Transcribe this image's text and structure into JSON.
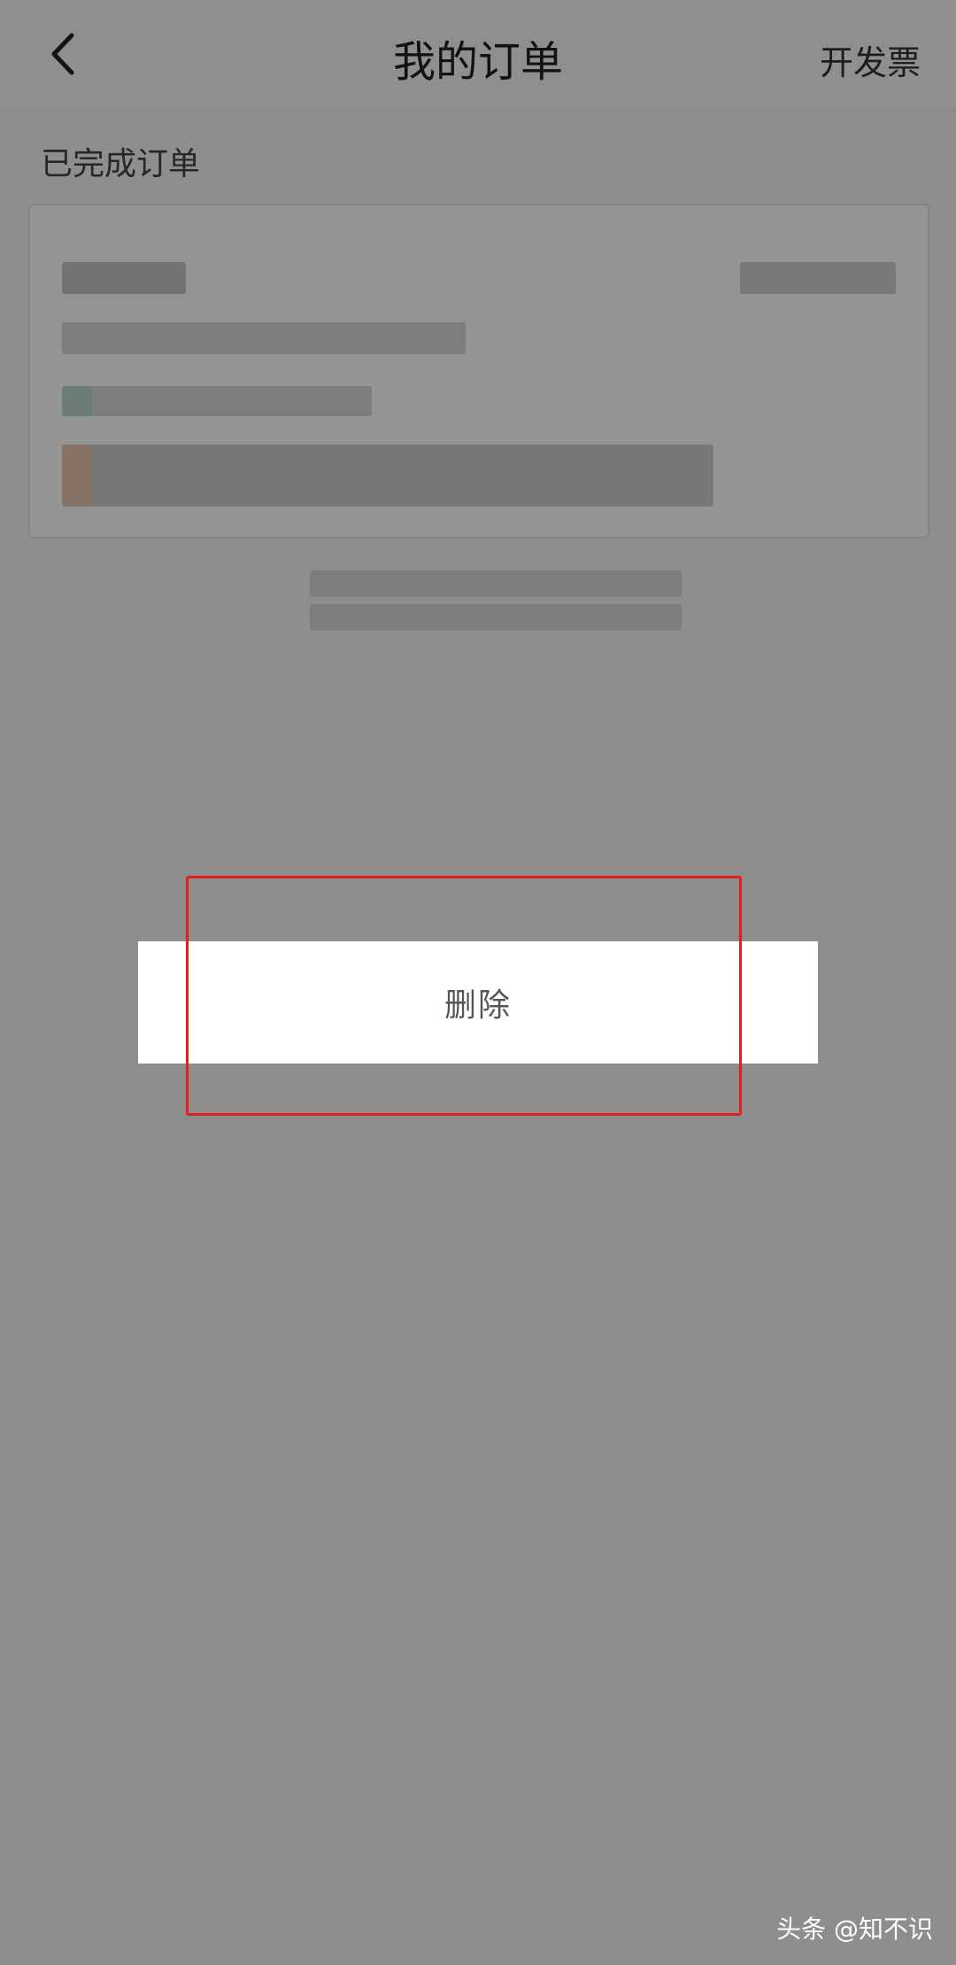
{
  "header": {
    "title": "我的订单",
    "right_action": "开发票",
    "back_icon": "chevron-left-icon"
  },
  "section": {
    "title": "已完成订单"
  },
  "action_sheet": {
    "delete_label": "删除"
  },
  "watermark": {
    "text": "头条 @知不识"
  },
  "colors": {
    "overlay": "#9a9a9a",
    "highlight": "#e02020",
    "sheet": "#ffffff"
  }
}
